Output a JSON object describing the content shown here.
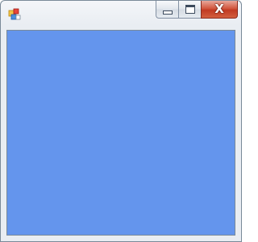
{
  "window": {
    "title": "",
    "client_color": "#6495ed"
  },
  "titlebar": {
    "app_icon": "windows-forms-app-icon",
    "minimize_icon": "minimize-icon",
    "maximize_icon": "maximize-icon",
    "close_icon": "close-icon",
    "close_glyph": "X"
  },
  "colors": {
    "client_background": "#6495ed",
    "close_button": "#c8452c",
    "frame": "#e9edf2"
  }
}
